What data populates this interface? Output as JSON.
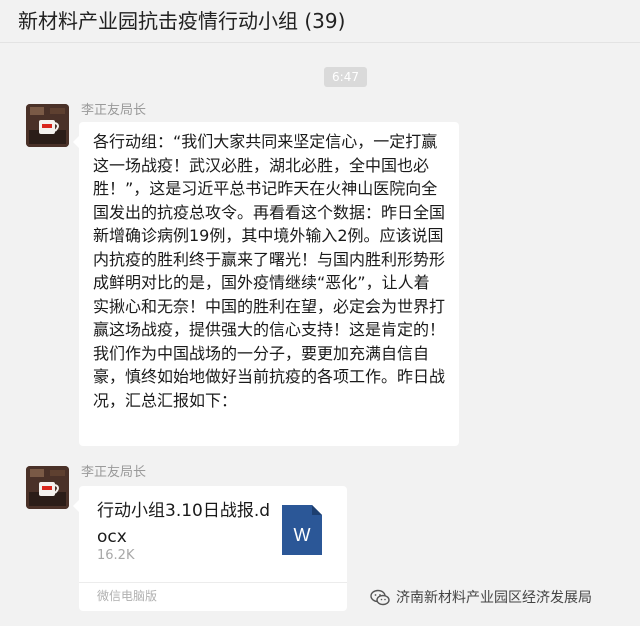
{
  "header": {
    "title": "新材料产业园抗击疫情行动小组 (39)"
  },
  "timestamp": "6:47",
  "messages": [
    {
      "sender": "李正友局长",
      "text": "各行动组：“我们大家共同来坚定信心，一定打赢这一场战疫！武汉必胜，湖北必胜，全中国也必胜！”，这是习近平总书记昨天在火神山医院向全国发出的抗疫总攻令。再看看这个数据：昨日全国新增确诊病例19例，其中境外输入2例。应该说国内抗疫的胜利终于赢来了曙光！与国内胜利形势形成鲜明对比的是，国外疫情继续“恶化”，让人着实揪心和无奈！中国的胜利在望，必定会为世界打赢这场战疫，提供强大的信心支持！这是肯定的！我们作为中国战场的一分子，要更加充满自信自豪，慎终如始地做好当前抗疫的各项工作。昨日战况，汇总汇报如下："
    },
    {
      "sender": "李正友局长",
      "file": {
        "name": "行动小组3.10日战报.docx",
        "size": "16.2K",
        "source": "微信电脑版",
        "icon": "word-document-icon",
        "icon_letter": "W",
        "icon_color": "#2b5797"
      }
    }
  ],
  "watermark": {
    "text": "济南新材料产业园区经济发展局",
    "icon": "wechat-official-account-icon"
  }
}
